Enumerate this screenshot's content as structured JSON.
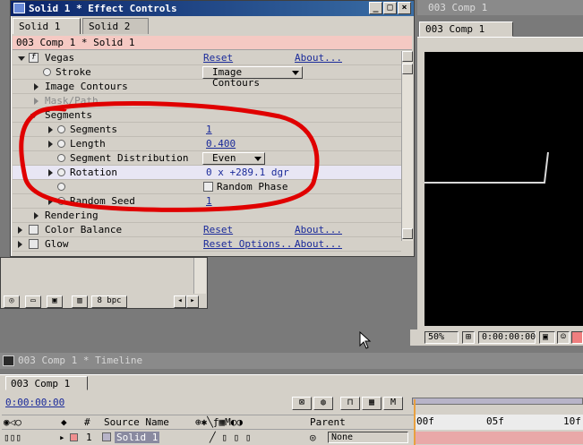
{
  "effect_controls": {
    "title": "Solid 1 * Effect Controls",
    "tabs": [
      "Solid 1",
      "Solid 2"
    ],
    "header": "003 Comp 1 * Solid 1",
    "rows": {
      "vegas": {
        "label": "Vegas",
        "reset": "Reset",
        "about": "About..."
      },
      "stroke": {
        "label": "Stroke",
        "value": "Image Contours"
      },
      "image_contours": {
        "label": "Image Contours"
      },
      "mask_path": {
        "label": "Mask/Path"
      },
      "segments_group": {
        "label": "Segments"
      },
      "segments": {
        "label": "Segments",
        "value": "1"
      },
      "length": {
        "label": "Length",
        "value": "0.400"
      },
      "segment_distribution": {
        "label": "Segment Distribution",
        "value": "Even"
      },
      "rotation": {
        "label": "Rotation",
        "value": "0 x +289.1 dgr"
      },
      "random_phase": {
        "label": "Random Phase"
      },
      "random_seed": {
        "label": "Random Seed",
        "value": "1"
      },
      "rendering": {
        "label": "Rendering"
      },
      "color_balance": {
        "label": "Color Balance",
        "reset": "Reset",
        "about": "About..."
      },
      "glow": {
        "label": "Glow",
        "reset": "Reset Options...",
        "about": "About..."
      }
    }
  },
  "project": {
    "bit_depth": "8 bpc"
  },
  "composition": {
    "title": "003 Comp 1",
    "tab": "003 Comp 1",
    "zoom": "50%",
    "timecode": "0:00:00:00"
  },
  "timeline": {
    "title": "003 Comp 1 * Timeline",
    "tab": "003 Comp 1",
    "time": "0:00:00:00",
    "columns": {
      "number": "#",
      "source_name": "Source Name",
      "parent": "Parent"
    },
    "layer": {
      "number": "1",
      "name": "Solid 1",
      "parent": "None"
    },
    "ruler": [
      "00f",
      "05f",
      "10f"
    ]
  },
  "colors": {
    "annotation": "#e00000",
    "header_pink": "#f5c9c3",
    "link_blue": "#1a2a9a"
  }
}
